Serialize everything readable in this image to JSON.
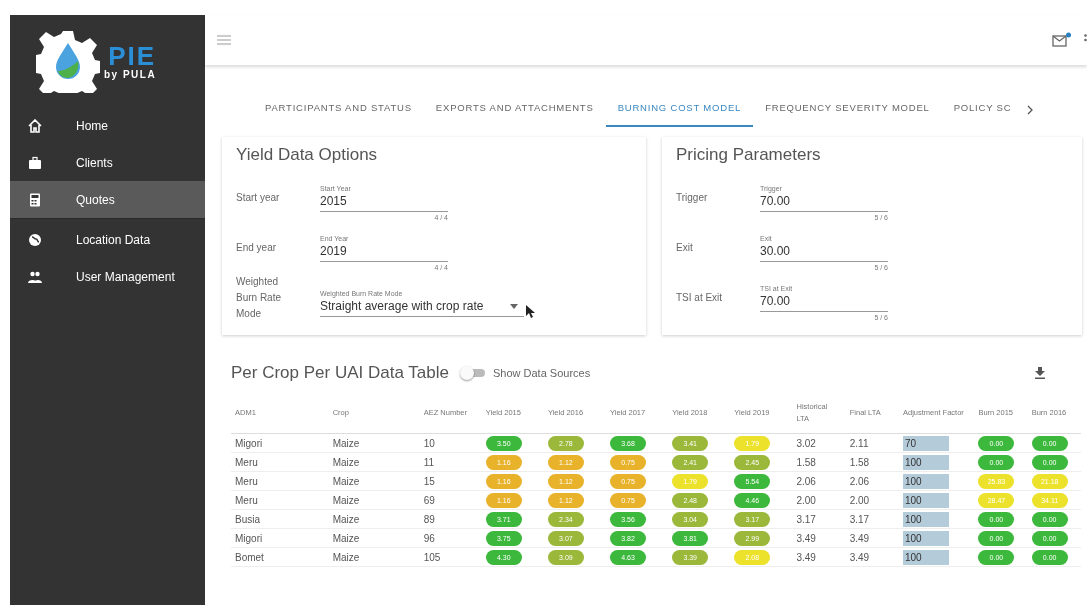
{
  "brand": {
    "name": "PIE",
    "sub": "by PULA"
  },
  "sidebar": {
    "items": [
      {
        "label": "Home",
        "selected": false
      },
      {
        "label": "Clients",
        "selected": false
      },
      {
        "label": "Quotes",
        "selected": true
      },
      {
        "label": "Location Data",
        "selected": false
      },
      {
        "label": "User Management",
        "selected": false
      }
    ]
  },
  "topbar": {
    "mail_unread": true
  },
  "tabs": [
    {
      "label": "PARTICIPANTS AND STATUS",
      "selected": false
    },
    {
      "label": "EXPORTS AND ATTACHMENTS",
      "selected": false
    },
    {
      "label": "BURNING COST MODEL",
      "selected": true
    },
    {
      "label": "FREQUENCY SEVERITY MODEL",
      "selected": false
    },
    {
      "label": "POLICY SC",
      "selected": false
    }
  ],
  "cards": [
    {
      "title": "Yield Data Options",
      "rows": [
        {
          "kind": "text",
          "label": "Start year",
          "field_label": "Start Year",
          "value": "2015",
          "counter": "4 / 4"
        },
        {
          "kind": "text",
          "label": "End year",
          "field_label": "End Year",
          "value": "2019",
          "counter": "4 / 4"
        },
        {
          "kind": "select",
          "label": "Weighted Burn Rate Mode",
          "field_label": "Weighted Burn Rate Mode",
          "value": "Straight average with crop rate"
        }
      ]
    },
    {
      "title": "Pricing Parameters",
      "rows": [
        {
          "kind": "text",
          "label": "Trigger",
          "field_label": "Trigger",
          "value": "70.00",
          "counter": "5 / 6"
        },
        {
          "kind": "text",
          "label": "Exit",
          "field_label": "Exit",
          "value": "30.00",
          "counter": "5 / 6"
        },
        {
          "kind": "text",
          "label": "TSI at Exit",
          "field_label": "TSI at Exit",
          "value": "70.00",
          "counter": "5 / 6"
        }
      ]
    }
  ],
  "table": {
    "title": "Per Crop Per UAI Data Table",
    "toggle": {
      "label": "Show Data Sources",
      "on": false
    },
    "columns": [
      {
        "label": "ADM1",
        "kind": "text"
      },
      {
        "label": "Crop",
        "kind": "text"
      },
      {
        "label": "AEZ Number",
        "kind": "text"
      },
      {
        "label": "Yield 2015",
        "kind": "pill"
      },
      {
        "label": "Yield 2016",
        "kind": "pill"
      },
      {
        "label": "Yield 2017",
        "kind": "pill"
      },
      {
        "label": "Yield 2018",
        "kind": "pill"
      },
      {
        "label": "Yield 2019",
        "kind": "pill"
      },
      {
        "label": "Historical LTA",
        "kind": "text"
      },
      {
        "label": "Final LTA",
        "kind": "text"
      },
      {
        "label": "Adjustment Factor",
        "kind": "input"
      },
      {
        "label": "Burn 2015",
        "kind": "pill"
      },
      {
        "label": "Burn 2016",
        "kind": "pill"
      }
    ],
    "rows": [
      [
        {
          "text": "Migori"
        },
        {
          "text": "Maize"
        },
        {
          "text": "10"
        },
        {
          "text": "3.50",
          "color": "#3cb83c"
        },
        {
          "text": "2.78",
          "color": "#9bb83a"
        },
        {
          "text": "3.68",
          "color": "#3cb83c"
        },
        {
          "text": "3.41",
          "color": "#9bb83a"
        },
        {
          "text": "1.79",
          "color": "#ece22c"
        },
        {
          "text": "3.02"
        },
        {
          "text": "2.11"
        },
        {
          "text": "70"
        },
        {
          "text": "0.00",
          "color": "#3cb83c"
        },
        {
          "text": "0.00",
          "color": "#3cb83c"
        }
      ],
      [
        {
          "text": "Meru"
        },
        {
          "text": "Maize"
        },
        {
          "text": "11"
        },
        {
          "text": "1.16",
          "color": "#e8b22a"
        },
        {
          "text": "1.12",
          "color": "#e8b22a"
        },
        {
          "text": "0.75",
          "color": "#e8b22a"
        },
        {
          "text": "2.41",
          "color": "#9bb83a"
        },
        {
          "text": "2.45",
          "color": "#9bb83a"
        },
        {
          "text": "1.58"
        },
        {
          "text": "1.58"
        },
        {
          "text": "100"
        },
        {
          "text": "0.00",
          "color": "#3cb83c"
        },
        {
          "text": "0.00",
          "color": "#3cb83c"
        }
      ],
      [
        {
          "text": "Meru"
        },
        {
          "text": "Maize"
        },
        {
          "text": "15"
        },
        {
          "text": "1.16",
          "color": "#e8b22a"
        },
        {
          "text": "1.12",
          "color": "#e8b22a"
        },
        {
          "text": "0.75",
          "color": "#e8b22a"
        },
        {
          "text": "1.79",
          "color": "#ece22c"
        },
        {
          "text": "5.54",
          "color": "#3cb83c"
        },
        {
          "text": "2.06"
        },
        {
          "text": "2.06"
        },
        {
          "text": "100"
        },
        {
          "text": "25.83",
          "color": "#ece22c"
        },
        {
          "text": "21.18",
          "color": "#ece22c"
        }
      ],
      [
        {
          "text": "Meru"
        },
        {
          "text": "Maize"
        },
        {
          "text": "69"
        },
        {
          "text": "1.16",
          "color": "#e8b22a"
        },
        {
          "text": "1.12",
          "color": "#e8b22a"
        },
        {
          "text": "0.75",
          "color": "#e8b22a"
        },
        {
          "text": "2.48",
          "color": "#9bb83a"
        },
        {
          "text": "4.46",
          "color": "#3cb83c"
        },
        {
          "text": "2.00"
        },
        {
          "text": "2.00"
        },
        {
          "text": "100"
        },
        {
          "text": "28.47",
          "color": "#ece22c"
        },
        {
          "text": "34.11",
          "color": "#ece22c"
        }
      ],
      [
        {
          "text": "Busia"
        },
        {
          "text": "Maize"
        },
        {
          "text": "89"
        },
        {
          "text": "3.71",
          "color": "#3cb83c"
        },
        {
          "text": "2.34",
          "color": "#9bb83a"
        },
        {
          "text": "3.56",
          "color": "#3cb83c"
        },
        {
          "text": "3.04",
          "color": "#9bb83a"
        },
        {
          "text": "3.17",
          "color": "#9bb83a"
        },
        {
          "text": "3.17"
        },
        {
          "text": "3.17"
        },
        {
          "text": "100"
        },
        {
          "text": "0.00",
          "color": "#3cb83c"
        },
        {
          "text": "0.00",
          "color": "#3cb83c"
        }
      ],
      [
        {
          "text": "Migori"
        },
        {
          "text": "Maize"
        },
        {
          "text": "96"
        },
        {
          "text": "3.75",
          "color": "#3cb83c"
        },
        {
          "text": "3.07",
          "color": "#9bb83a"
        },
        {
          "text": "3.82",
          "color": "#3cb83c"
        },
        {
          "text": "3.81",
          "color": "#3cb83c"
        },
        {
          "text": "2.99",
          "color": "#9bb83a"
        },
        {
          "text": "3.49"
        },
        {
          "text": "3.49"
        },
        {
          "text": "100"
        },
        {
          "text": "0.00",
          "color": "#3cb83c"
        },
        {
          "text": "0.00",
          "color": "#3cb83c"
        }
      ],
      [
        {
          "text": "Bomet"
        },
        {
          "text": "Maize"
        },
        {
          "text": "105"
        },
        {
          "text": "4.30",
          "color": "#3cb83c"
        },
        {
          "text": "3.09",
          "color": "#9bb83a"
        },
        {
          "text": "4.63",
          "color": "#3cb83c"
        },
        {
          "text": "3.39",
          "color": "#9bb83a"
        },
        {
          "text": "2.08",
          "color": "#ece22c"
        },
        {
          "text": "3.49"
        },
        {
          "text": "3.49"
        },
        {
          "text": "100"
        },
        {
          "text": "0.00",
          "color": "#3cb83c"
        },
        {
          "text": "0.00",
          "color": "#3cb83c"
        }
      ]
    ]
  }
}
